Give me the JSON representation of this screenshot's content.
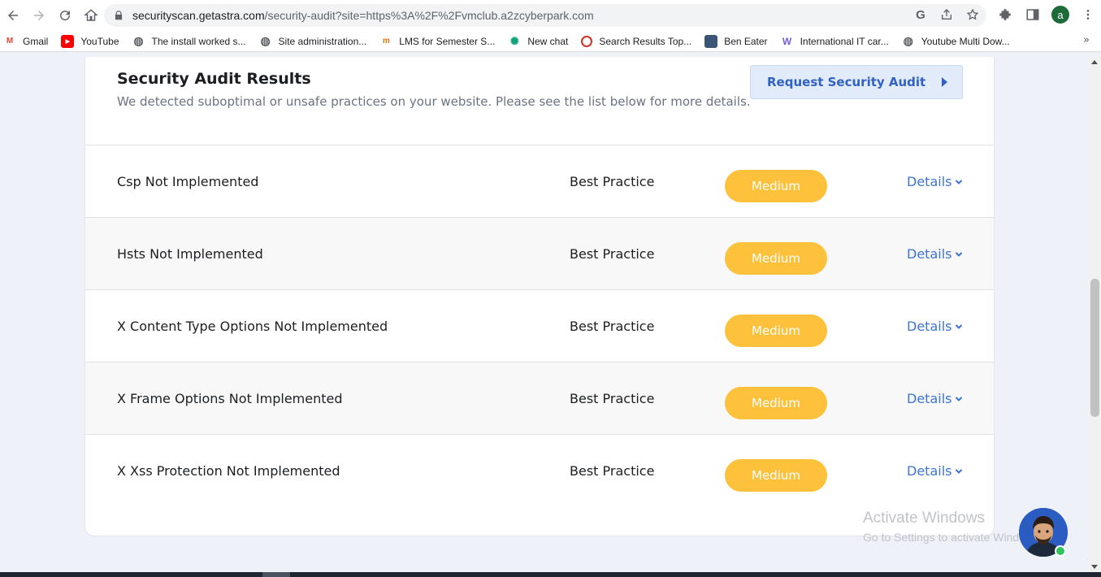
{
  "browser": {
    "url_host": "securityscan.getastra.com",
    "url_path": "/security-audit?site=https%3A%2F%2Fvmclub.a2zcyberpark.com",
    "profile_initial": "a"
  },
  "bookmarks": [
    {
      "label": "Gmail",
      "icon": "gmail-icon"
    },
    {
      "label": "YouTube",
      "icon": "youtube-icon"
    },
    {
      "label": "The install worked s...",
      "icon": "globe-icon"
    },
    {
      "label": "Site administration...",
      "icon": "globe-icon"
    },
    {
      "label": "LMS for Semester S...",
      "icon": "lms-icon"
    },
    {
      "label": "New chat",
      "icon": "chatgpt-icon"
    },
    {
      "label": "Search Results Top...",
      "icon": "search-results-icon"
    },
    {
      "label": "Ben Eater",
      "icon": "ben-eater-icon"
    },
    {
      "label": "International IT car...",
      "icon": "international-it-icon"
    },
    {
      "label": "Youtube Multi Dow...",
      "icon": "globe-icon"
    }
  ],
  "audit": {
    "title": "Security Audit Results",
    "subtitle": "We detected suboptimal or unsafe practices on your website. Please see the list below for more details.",
    "request_button": "Request Security Audit",
    "rows": [
      {
        "name": "Csp Not Implemented",
        "category": "Best Practice",
        "severity": "Medium",
        "details": "Details"
      },
      {
        "name": "Hsts Not Implemented",
        "category": "Best Practice",
        "severity": "Medium",
        "details": "Details"
      },
      {
        "name": "X Content Type Options Not Implemented",
        "category": "Best Practice",
        "severity": "Medium",
        "details": "Details"
      },
      {
        "name": "X Frame Options Not Implemented",
        "category": "Best Practice",
        "severity": "Medium",
        "details": "Details"
      },
      {
        "name": "X Xss Protection Not Implemented",
        "category": "Best Practice",
        "severity": "Medium",
        "details": "Details"
      }
    ]
  },
  "watermark": {
    "line1": "Activate Windows",
    "line2": "Go to Settings to activate Windows."
  },
  "colors": {
    "severity_medium": "#fdc13b",
    "link_blue": "#3c73d4",
    "button_bg": "#e2ebf9"
  }
}
